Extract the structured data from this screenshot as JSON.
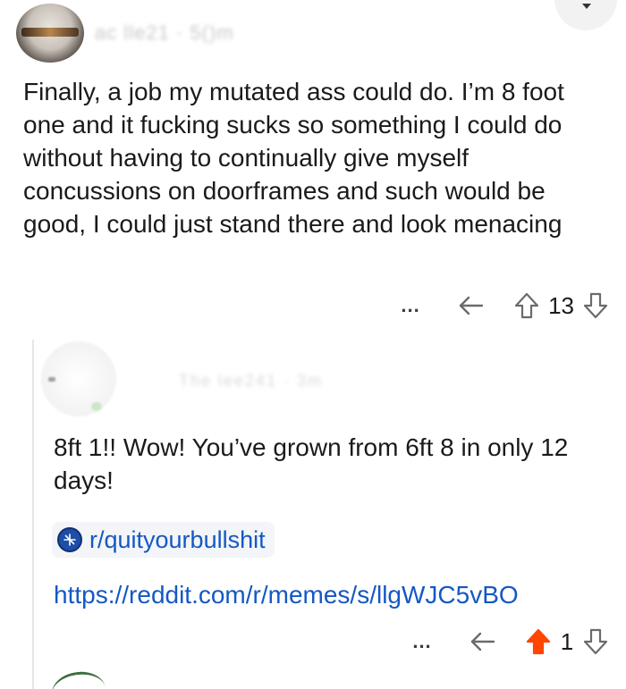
{
  "top_comment": {
    "username": "ac        lle21 · 5()m",
    "body": "Finally, a job my mutated ass could do. I’m 8 foot one and it fucking sucks so something I could do without having to continually give myself concussions on doorframes and such would be good, I could just stand there and look menacing",
    "vote_count": "13",
    "more_label": "..."
  },
  "reply_comment": {
    "username": "The   lee241 · 3m",
    "body": "8ft 1!! Wow! You’ve grown from 6ft 8 in only 12 days!",
    "subreddit": "r/quityourbullshit",
    "link": "https://reddit.com/r/memes/s/llgWJC5vBO",
    "vote_count": "1",
    "more_label": "...",
    "upvoted": true
  },
  "colors": {
    "upvote_active": "#ff4500",
    "link": "#1458c4",
    "icon_gray": "#7c7c7c"
  },
  "icons": [
    "reply-icon",
    "upvote-icon",
    "downvote-icon",
    "more-icon",
    "subreddit-icon",
    "chevron-down-icon"
  ]
}
